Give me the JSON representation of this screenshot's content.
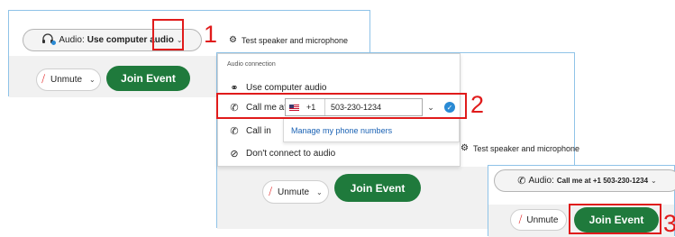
{
  "step1": {
    "audio_label": "Audio:",
    "audio_value": "Use computer audio",
    "test_speaker": "Test speaker and microphone",
    "unmute": "Unmute",
    "join": "Join Event",
    "number": "1"
  },
  "step2": {
    "header": "Audio connection",
    "options": {
      "use_computer_audio": "Use computer audio",
      "call_me_at": "Call me at",
      "call_in": "Call in",
      "dont_connect": "Don't connect to audio"
    },
    "country_code": "+1",
    "phone_value": "503-230-1234",
    "manage_numbers": "Manage my phone numbers",
    "test_speaker": "Test speaker and microphone",
    "unmute": "Unmute",
    "join": "Join Event",
    "number": "2"
  },
  "step3": {
    "audio_label": "Audio:",
    "audio_value": "Call me at +1 503-230-1234",
    "unmute": "Unmute",
    "join": "Join Event",
    "number": "3"
  },
  "colors": {
    "accent_green": "#1f7a3c",
    "highlight_red": "#e01b1b",
    "panel_border": "#8fc3e8",
    "link_blue": "#1a62b4"
  }
}
